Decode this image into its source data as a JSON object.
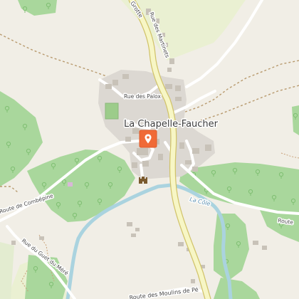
{
  "map": {
    "place_name": "La Chapelle-Faucher",
    "river_name": "La Côle",
    "streets": {
      "top_road": "Grotte",
      "rue_martinets": "Rue des Martinets",
      "rue_palox": "Rue des Palox",
      "route_combepine": "Route de Combépine",
      "rue_guet": "Rue du Guet du Méré",
      "route_moulins": "Route des Moulins de Pé",
      "route_right": "Route"
    },
    "marker": {
      "icon": "location-pin-icon",
      "color": "#f06a37"
    },
    "poi": {
      "icon": "castle-icon"
    },
    "colors": {
      "background": "#f1eee6",
      "forest": "#a9d79c",
      "meadow": "#eaf0d2",
      "river": "#aad3df",
      "main_road": "#f7f6c5",
      "main_road_casing": "#d1c36a",
      "built_area": "#dcd8d2",
      "building": "#c8c2b8"
    }
  }
}
